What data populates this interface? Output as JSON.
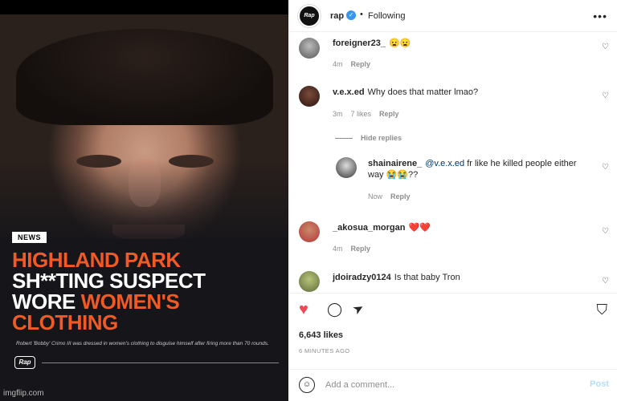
{
  "media": {
    "news_tag": "NEWS",
    "headline": {
      "line1": "HIGHLAND PARK",
      "line2": "SH**TING SUSPECT",
      "line3_white": "WORE ",
      "line3_orange": "WOMEN'S",
      "line4": "CLOTHING"
    },
    "caption": "Robert 'Bobby' Crimo III was dressed in women's clothing to disguise himself after firing more than 70 rounds.",
    "brand": "Rap",
    "watermark": "imgflip.com"
  },
  "header": {
    "avatar_text": "Rap",
    "username": "rap",
    "verified_icon": "✓",
    "separator": "•",
    "following": "Following",
    "more_icon": "•••"
  },
  "comments": [
    {
      "user": "foreigner23_",
      "text": "😦😦",
      "time": "4m",
      "likes": "",
      "reply": "Reply"
    },
    {
      "user": "v.e.x.ed",
      "text": "Why does that matter lmao?",
      "time": "3m",
      "likes": "7 likes",
      "reply": "Reply"
    },
    {
      "user": "shainairene_",
      "mention": "@v.e.x.ed",
      "text": " fr like he killed people either way 😭😭??",
      "time": "Now",
      "likes": "",
      "reply": "Reply"
    },
    {
      "user": "_akosua_morgan",
      "text": "❤️❤️",
      "time": "4m",
      "likes": "",
      "reply": "Reply"
    },
    {
      "user": "jdoiradzy0124",
      "text": "Is that baby Tron"
    }
  ],
  "hide_replies": "Hide replies",
  "actions": {
    "like_icon": "♥",
    "comment_icon": "◯",
    "share_icon": "➤",
    "save_icon": "⛉",
    "likes": "6,643 likes",
    "time_ago": "6 MINUTES AGO"
  },
  "add_comment": {
    "emoji_icon": "☺",
    "placeholder": "Add a comment...",
    "post": "Post"
  },
  "colors": {
    "accent_orange": "#f15a24",
    "heart_red": "#ed4956",
    "link_blue": "#00376b",
    "post_disabled": "#b2dffc"
  }
}
